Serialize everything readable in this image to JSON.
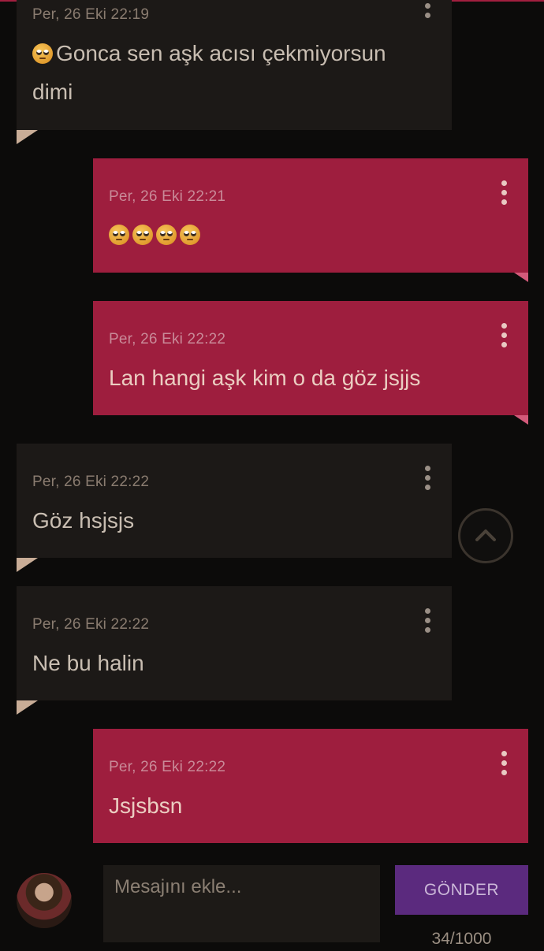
{
  "messages": [
    {
      "side": "in",
      "meta": "Per, 26 Eki 22:19",
      "text": "Gonca sen aşk acısı çekmiyorsun dimi",
      "emoji_prefix": 1
    },
    {
      "side": "out",
      "meta": "Per, 26 Eki 22:21",
      "text": "",
      "emoji_count": 4
    },
    {
      "side": "out",
      "meta": "Per, 26 Eki 22:22",
      "text": "Lan hangi aşk kim o da göz jsjjs"
    },
    {
      "side": "in",
      "meta": "Per, 26 Eki 22:22",
      "text": "Göz hsjsjs"
    },
    {
      "side": "in",
      "meta": "Per, 26 Eki 22:22",
      "text": "Ne bu halin"
    },
    {
      "side": "out",
      "meta": "Per, 26 Eki 22:22",
      "text": "Jsjsbsn"
    }
  ],
  "emoji": {
    "name": "face-with-rolling-eyes"
  },
  "composer": {
    "placeholder": "Mesajını ekle...",
    "send_label": "GÖNDER",
    "counter": "34/1000"
  },
  "icons": {
    "menu": "kebab-menu-icon",
    "scroll_up": "chevron-up-icon",
    "avatar": "user-avatar"
  },
  "colors": {
    "incoming_bg": "#1c1917",
    "outgoing_bg": "#9e1e3e",
    "send_button": "#5b2a7e",
    "page_bg": "#0c0b0a"
  }
}
